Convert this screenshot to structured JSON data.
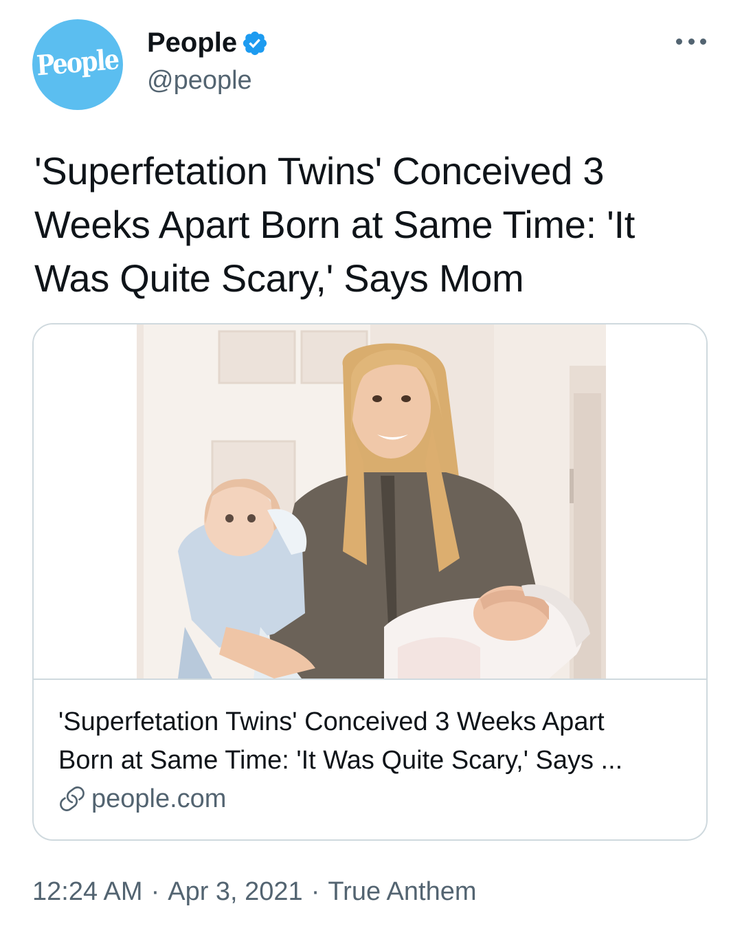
{
  "author": {
    "avatar_text": "People",
    "display_name": "People",
    "handle": "@people",
    "verified": true,
    "avatar_color": "#5bbef0",
    "verified_color": "#1d9bf0"
  },
  "tweet": {
    "text": "'Superfetation Twins' Conceived 3 Weeks Apart Born at Same Time: 'It Was Quite Scary,' Says Mom"
  },
  "card": {
    "title": "'Superfetation Twins' Conceived 3 Weeks Apart\nBorn at Same Time: 'It Was Quite Scary,' Says ...",
    "domain": "people.com",
    "image_icon": "photo-mother-with-twins"
  },
  "meta": {
    "time": "12:24 AM",
    "separator": "·",
    "date": "Apr 3, 2021",
    "source": "True Anthem"
  },
  "icons": {
    "more": "more-horizontal-icon",
    "verified": "verified-badge-icon",
    "link": "link-icon"
  }
}
